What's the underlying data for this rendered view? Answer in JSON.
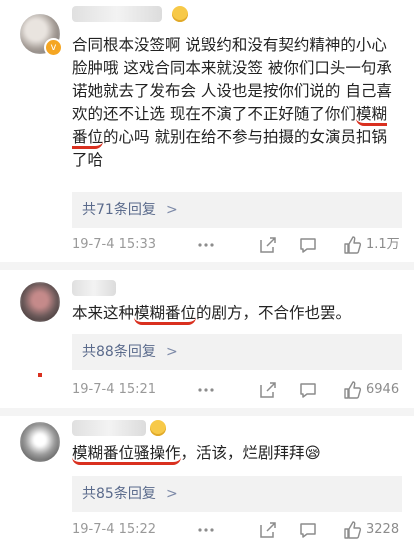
{
  "comments": [
    {
      "username": "",
      "body": {
        "text_before": "合同根本没签啊 说毁约和没有契约精神的小心脸肿哦 这戏合同本来就没签 被你们口头一句承诺她就去了发布会 人设也是按你们说的 自己喜欢的还不让选 现在不演了不正好随了你们",
        "highlight": "模糊番位",
        "text_after": "的心吗 就别在给不参与拍摄的女演员扣锅了哈"
      },
      "replies_label": "共71条回复",
      "reply_chevron": ">",
      "date": "19-7-4 15:33",
      "likes": "1.1万",
      "icons": [
        "more-icon",
        "share-icon",
        "comment-icon",
        "like-icon"
      ]
    },
    {
      "username": "",
      "body": {
        "text_before": "本来这种",
        "highlight": "模糊番位",
        "text_after": "的剧方，不合作也罢。"
      },
      "replies_label": "共88条回复",
      "reply_chevron": ">",
      "date": "19-7-4 15:21",
      "likes": "6946"
    },
    {
      "username": "",
      "body": {
        "text_before": "",
        "highlight": "模糊番位骚操作",
        "text_after": "，活该，烂剧拜拜😪"
      },
      "replies_label": "共85条回复",
      "reply_chevron": ">",
      "date": "19-7-4 15:22",
      "likes": "3228"
    }
  ],
  "colors": {
    "accent_underline": "#d9301f",
    "link_blue": "#5b6b8c",
    "meta_gray": "#999999",
    "badge_orange": "#f5a623"
  }
}
